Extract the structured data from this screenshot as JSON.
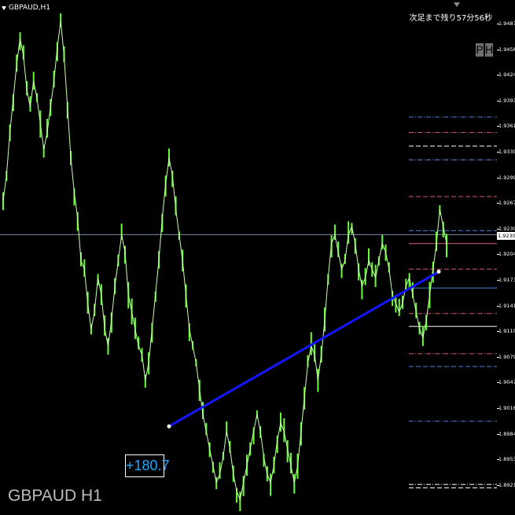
{
  "window": {
    "symbol_tab": "GBPAUD,H1",
    "countdown": "次足まで残り57分56秒",
    "ph_buttons": [
      "P",
      "H"
    ],
    "chart_label": "GBPAUD H1",
    "pips_label": "+180.7",
    "current_price_label": "1.92305"
  },
  "colors": {
    "background": "#000000",
    "candle": "#66ff33",
    "trendline": "#1515ff",
    "pips_text": "#1ea7ff",
    "grid_text": "#ffffff"
  },
  "price_axis": {
    "labels": [
      "1.94875",
      "1.94560",
      "1.94245",
      "1.93930",
      "1.93615",
      "1.93300",
      "1.92990",
      "1.92675",
      "1.92305",
      "1.92045",
      "1.91730",
      "1.91415",
      "1.91100",
      "1.90790",
      "1.90475",
      "1.90160",
      "1.89845",
      "1.89530",
      "1.89215"
    ]
  },
  "level_lines": [
    {
      "price": 1.9368,
      "color": "#4a7fd4",
      "style": "dashdot"
    },
    {
      "price": 1.935,
      "color": "#d45a6a",
      "style": "dashdot"
    },
    {
      "price": 1.9334,
      "color": "#ffffff",
      "style": "dashed"
    },
    {
      "price": 1.9318,
      "color": "#6a8fe0",
      "style": "dashdot"
    },
    {
      "price": 1.9275,
      "color": "#d45a6a",
      "style": "dashed"
    },
    {
      "price": 1.9235,
      "color": "#4a7fd4",
      "style": "dashed"
    },
    {
      "price": 1.922,
      "color": "#e06080",
      "style": "solid"
    },
    {
      "price": 1.919,
      "color": "#d45a6a",
      "style": "dashed"
    },
    {
      "price": 1.9168,
      "color": "#4a7fd4",
      "style": "solid"
    },
    {
      "price": 1.9138,
      "color": "#d45a6a",
      "style": "dashdot"
    },
    {
      "price": 1.9123,
      "color": "#ffffff",
      "style": "solid"
    },
    {
      "price": 1.9091,
      "color": "#d45a6a",
      "style": "dashdot"
    },
    {
      "price": 1.9076,
      "color": "#4a7fd4",
      "style": "dashed"
    },
    {
      "price": 1.9012,
      "color": "#4a7fd4",
      "style": "dashdot"
    },
    {
      "price": 1.8938,
      "color": "#ffffff",
      "style": "dashdot"
    },
    {
      "price": 1.8934,
      "color": "#ffffff",
      "style": "dashed"
    }
  ],
  "horizontal_price_line": 1.92305,
  "trendline": {
    "start_price": 1.9006,
    "end_price": 1.9187,
    "start_bar": 215,
    "end_bar": 558
  },
  "chart_data": {
    "type": "line",
    "title": "GBPAUD H1",
    "ylim": [
      1.8916,
      1.9494
    ],
    "series": [
      {
        "values": [
          1.927,
          1.93,
          1.935,
          1.939,
          1.943,
          1.946,
          1.944,
          1.94,
          1.938,
          1.941,
          1.939,
          1.936,
          1.933,
          1.935,
          1.938,
          1.941,
          1.945,
          1.948,
          1.944,
          1.938,
          1.932,
          1.928,
          1.925,
          1.92,
          1.919,
          1.915,
          1.912,
          1.914,
          1.918,
          1.916,
          1.912,
          1.91,
          1.913,
          1.917,
          1.92,
          1.923,
          1.921,
          1.916,
          1.914,
          1.912,
          1.91,
          1.909,
          1.906,
          1.908,
          1.912,
          1.916,
          1.92,
          1.925,
          1.929,
          1.932,
          1.93,
          1.926,
          1.923,
          1.92,
          1.916,
          1.912,
          1.91,
          1.908,
          1.905,
          1.902,
          1.9,
          1.898,
          1.896,
          1.894,
          1.895,
          1.897,
          1.9,
          1.898,
          1.895,
          1.893,
          1.892,
          1.894,
          1.896,
          1.898,
          1.9,
          1.902,
          1.9,
          1.897,
          1.895,
          1.894,
          1.896,
          1.899,
          1.901,
          1.9,
          1.898,
          1.896,
          1.894,
          1.896,
          1.9,
          1.904,
          1.908,
          1.91,
          1.909,
          1.906,
          1.909,
          1.913,
          1.918,
          1.922,
          1.923,
          1.921,
          1.919,
          1.92,
          1.923,
          1.924,
          1.922,
          1.919,
          1.917,
          1.918,
          1.92,
          1.919,
          1.918,
          1.92,
          1.922,
          1.921,
          1.919,
          1.916,
          1.915,
          1.914,
          1.915,
          1.917,
          1.918,
          1.916,
          1.914,
          1.912,
          1.911,
          1.913,
          1.916,
          1.919,
          1.922,
          1.926,
          1.924,
          1.922
        ]
      }
    ]
  }
}
